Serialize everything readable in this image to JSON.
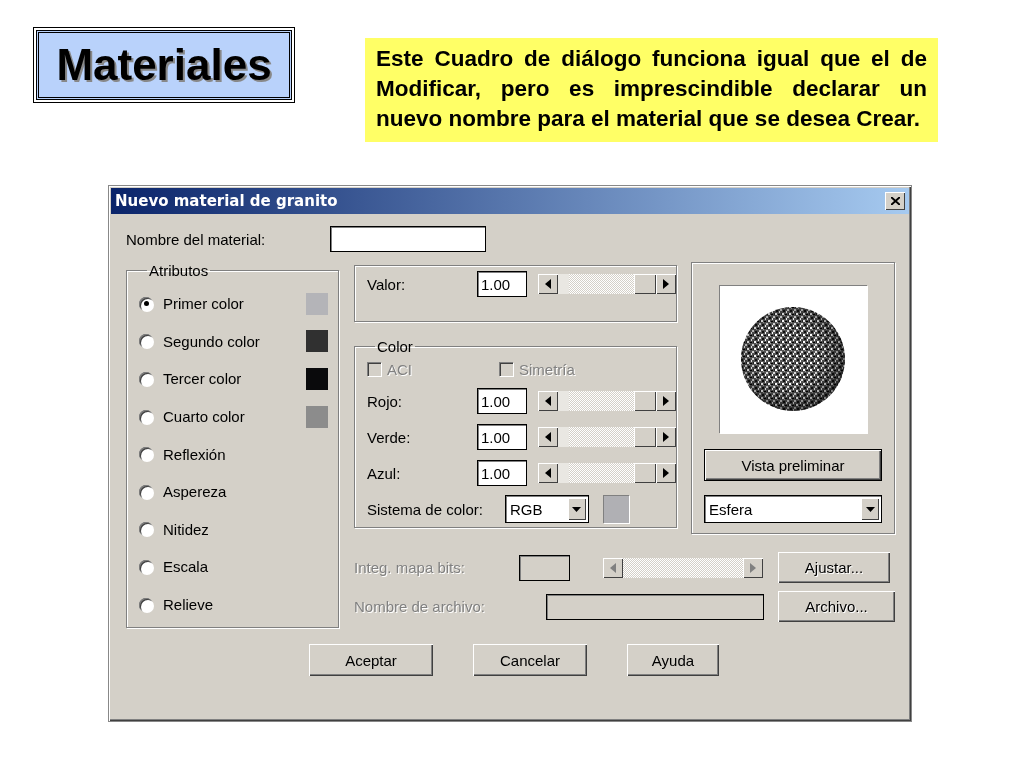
{
  "slide": {
    "title": "Materiales",
    "note": "Este Cuadro de diálogo funciona igual que el de Modificar, pero es imprescindible declarar un nuevo nombre para el material que se desea Crear."
  },
  "dialog": {
    "title": "Nuevo material de granito",
    "name_field": {
      "label": "Nombre del material:"
    },
    "attributes": {
      "legend": "Atributos",
      "items": [
        {
          "label": "Primer color",
          "selected": true,
          "color": "#b4b4b8"
        },
        {
          "label": "Segundo color",
          "selected": false,
          "color": "#303030"
        },
        {
          "label": "Tercer color",
          "selected": false,
          "color": "#0a0a0c"
        },
        {
          "label": "Cuarto color",
          "selected": false,
          "color": "#8c8c8c"
        },
        {
          "label": "Reflexión",
          "selected": false
        },
        {
          "label": "Aspereza",
          "selected": false
        },
        {
          "label": "Nitidez",
          "selected": false
        },
        {
          "label": "Escala",
          "selected": false
        },
        {
          "label": "Relieve",
          "selected": false
        }
      ]
    },
    "value": {
      "label": "Valor:",
      "value": "1.00",
      "level": 1
    },
    "color_group": {
      "legend": "Color",
      "checkboxes": [
        {
          "label": "ACI",
          "checked": false,
          "disabled": true
        },
        {
          "label": "Simetría",
          "checked": false,
          "disabled": true
        }
      ],
      "sliders": [
        {
          "label": "Rojo:",
          "value": "1.00",
          "level": 1
        },
        {
          "label": "Verde:",
          "value": "1.00",
          "level": 1
        },
        {
          "label": "Azul:",
          "value": "1.00",
          "level": 1
        }
      ],
      "system": {
        "label": "Sistema de color:",
        "value": "RGB"
      }
    },
    "preview": {
      "button": "Vista preliminar",
      "shape": "Esfera"
    },
    "bitmap": {
      "label": "Integ. mapa bits:",
      "disabled": true,
      "button": "Ajustar..."
    },
    "file": {
      "label": "Nombre de archivo:",
      "disabled": true,
      "button": "Archivo..."
    },
    "buttons": [
      "Aceptar",
      "Cancelar",
      "Ayuda"
    ]
  }
}
